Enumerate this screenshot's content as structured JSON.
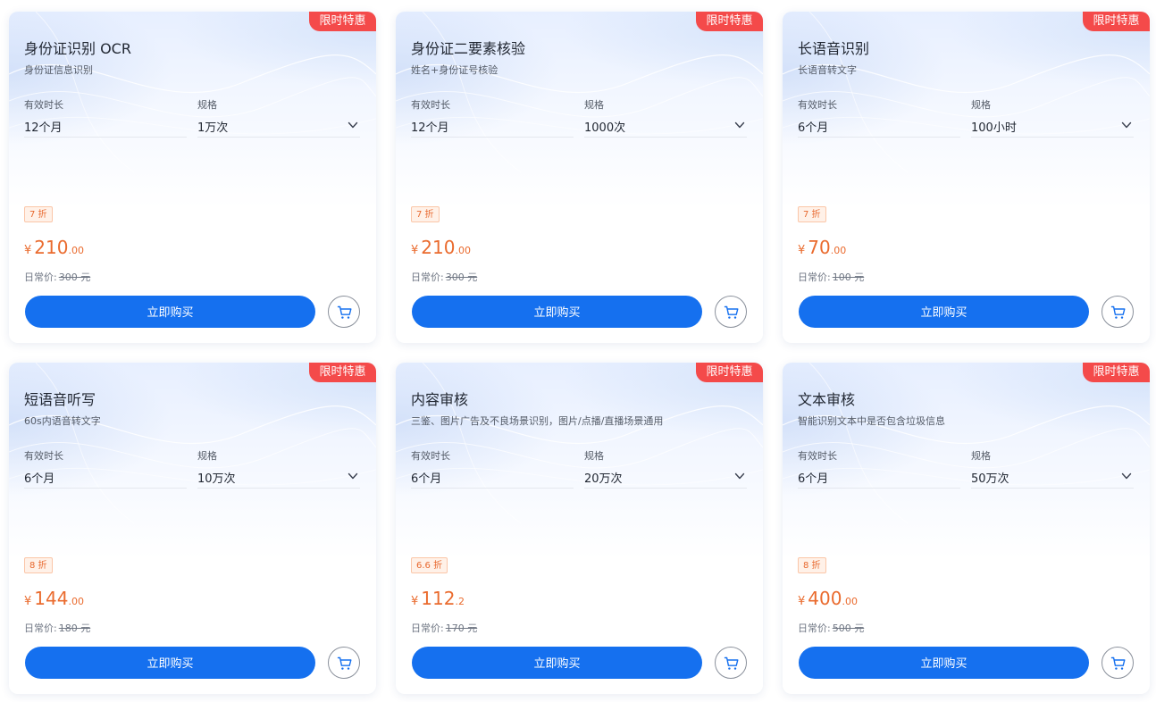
{
  "labels": {
    "badge": "限时特惠",
    "duration_label": "有效时长",
    "spec_label": "规格",
    "original_prefix": "日常价:",
    "buy_button": "立即购买",
    "currency": "¥"
  },
  "colors": {
    "primary": "#1570ef",
    "badge": "#f44a4a",
    "price": "#ea6b2e"
  },
  "products": [
    {
      "title": "身份证识别 OCR",
      "subtitle": "身份证信息识别",
      "duration": "12个月",
      "spec": "1万次",
      "discount": "7 折",
      "price_int": "210",
      "price_dec": ".00",
      "original": "300 元"
    },
    {
      "title": "身份证二要素核验",
      "subtitle": "姓名+身份证号核验",
      "duration": "12个月",
      "spec": "1000次",
      "discount": "7 折",
      "price_int": "210",
      "price_dec": ".00",
      "original": "300 元"
    },
    {
      "title": "长语音识别",
      "subtitle": "长语音转文字",
      "duration": "6个月",
      "spec": "100小时",
      "discount": "7 折",
      "price_int": "70",
      "price_dec": ".00",
      "original": "100 元"
    },
    {
      "title": "短语音听写",
      "subtitle": "60s内语音转文字",
      "duration": "6个月",
      "spec": "10万次",
      "discount": "8 折",
      "price_int": "144",
      "price_dec": ".00",
      "original": "180 元"
    },
    {
      "title": "内容审核",
      "subtitle": "三鉴、图片广告及不良场景识别，图片/点播/直播场景通用",
      "duration": "6个月",
      "spec": "20万次",
      "discount": "6.6 折",
      "price_int": "112",
      "price_dec": ".2",
      "original": "170 元"
    },
    {
      "title": "文本审核",
      "subtitle": "智能识别文本中是否包含垃圾信息",
      "duration": "6个月",
      "spec": "50万次",
      "discount": "8 折",
      "price_int": "400",
      "price_dec": ".00",
      "original": "500 元"
    }
  ]
}
